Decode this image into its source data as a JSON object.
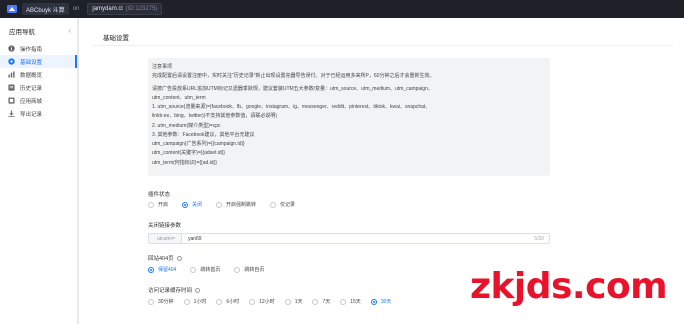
{
  "topbar": {
    "brand": "ABCbuyk 斗算",
    "separator": "on",
    "shop": "jamydam.cl",
    "shop_extra": "(ID:123275)"
  },
  "sidebar": {
    "title": "应用导航",
    "collapse_icon": "chevron-left-icon",
    "items": [
      {
        "label": "操作指南",
        "icon": "info-icon",
        "active": false
      },
      {
        "label": "基础设置",
        "icon": "gear-icon",
        "active": true
      },
      {
        "label": "数据概览",
        "icon": "chart-icon",
        "active": false
      },
      {
        "label": "历史记录",
        "icon": "history-icon",
        "active": false
      },
      {
        "label": "应用商城",
        "icon": "store-icon",
        "active": false
      },
      {
        "label": "导出记录",
        "icon": "download-icon",
        "active": false
      }
    ]
  },
  "main": {
    "title": "基础设置",
    "notice": [
      "注意事项",
      "完成配置后请设置注册中，实时关注\"历史记录\"新止出现设置完器导告误付。对于已经运用多来所P，60分钟之后才会重新生效。",
      "",
      "请按广告投放系URL追加UTM标记又遗器季默规，建议套装UTM五大参数/变量：utm_source、utm_medium、utm_campaign、",
      "utm_content、utm_term",
      "1. utm_source(流量来源)=(facebook、fb、google、instagram、ig、messenger、reddit、pinterest、tiktok、kwai、snapchat、",
      "linktr.ee、bing、twitter)(不支持其他参数值，请联必说明)",
      "2. utm_medium(媒介类型)=cpc",
      "3. 其他参数：Facebook建议，其他平台无建议",
      "utm_campaign(广告系列)={{campaign.id}}",
      "utm_content(关键字)={{adset.id}}",
      "utm_term(何指标识)={{ad.id}}"
    ],
    "plugin_status": {
      "label": "插件状态",
      "options": [
        "开启",
        "关闭",
        "开启强制跳转",
        "仅记录"
      ],
      "selected": 1
    },
    "close_param": {
      "label": "关闭链接参数",
      "prefix": "utcarin=",
      "value": "yan69",
      "count": "5/30"
    },
    "redirect_404": {
      "label": "回站404页",
      "options": [
        "保留404",
        "跳转首页",
        "跳转自页"
      ],
      "selected": 0
    },
    "cache_expiry": {
      "label": "访问记录缓存时间",
      "options": [
        "30分钟",
        "1小时",
        "6小时",
        "12小时",
        "1天",
        "7天",
        "15天",
        "30天"
      ],
      "selected": 7
    }
  },
  "watermark": "zkjds.com",
  "colors": {
    "accent": "#1677ff",
    "topbar": "#1f2129",
    "watermark": "#e8132b"
  }
}
